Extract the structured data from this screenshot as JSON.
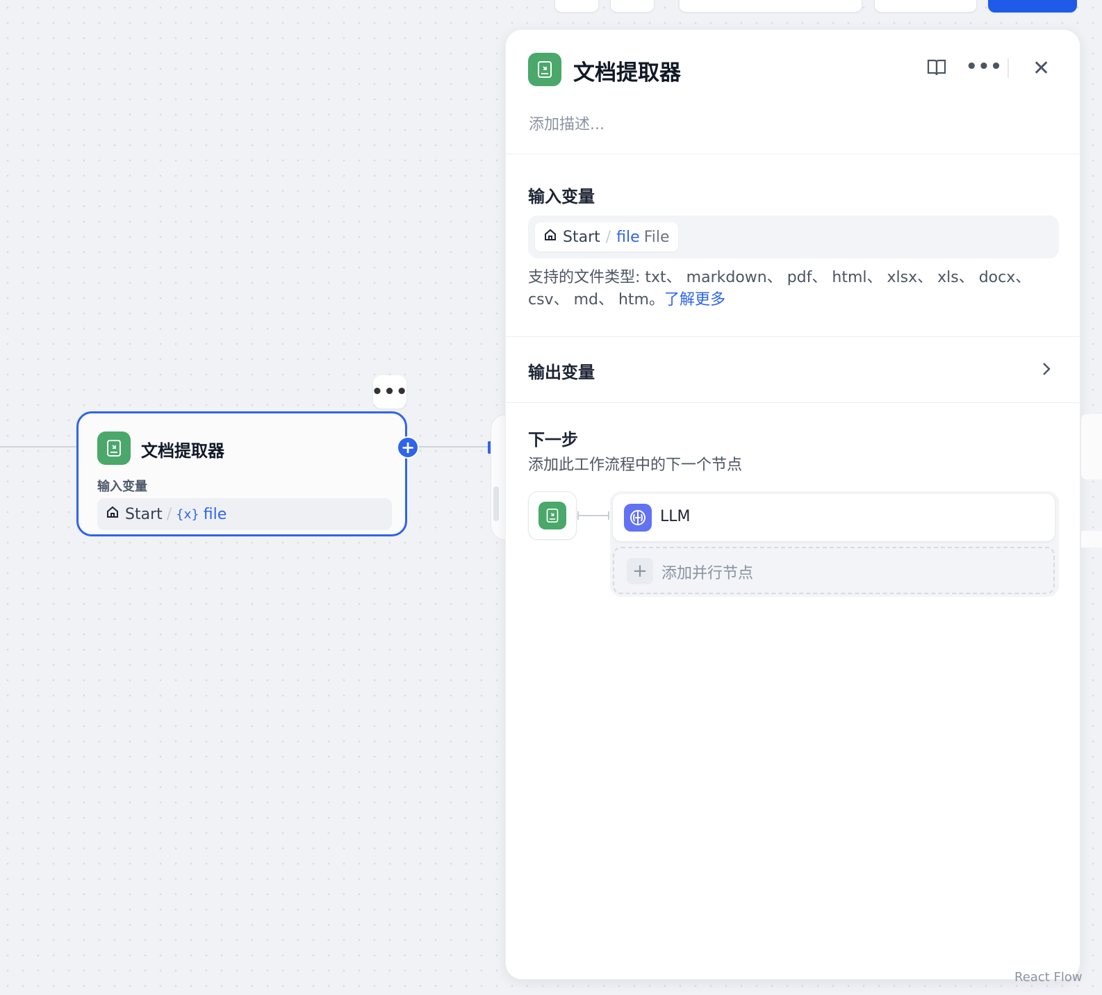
{
  "canvas_node": {
    "title": "文档提取器",
    "input_label": "输入变量",
    "var_source": "Start",
    "var_separator": "/",
    "var_brace": "{x}",
    "var_name": "file",
    "more_label": "•••",
    "add_label": "+"
  },
  "panel": {
    "title": "文档提取器",
    "description_placeholder": "添加描述...",
    "more_label": "•••",
    "close_label": "✕",
    "input_section": {
      "title": "输入变量",
      "var_source": "Start",
      "var_separator": "/",
      "var_name": "file",
      "var_type": "File",
      "support_text": "支持的文件类型: txt、 markdown、 pdf、 html、 xlsx、 xls、 docx、 csv、 md、 htm。",
      "learn_more": "了解更多"
    },
    "output_section": {
      "title": "输出变量"
    },
    "next_step": {
      "title": "下一步",
      "subtitle": "添加此工作流程中的下一个节点",
      "next_node_label": "LLM",
      "add_parallel_label": "添加并行节点",
      "add_parallel_icon": "+"
    }
  },
  "footer": {
    "attribution": "React Flow"
  },
  "colors": {
    "accent": "#2f64eb",
    "doc_icon_bg": "#49a86a",
    "llm_icon_bg": "#6172f3"
  }
}
